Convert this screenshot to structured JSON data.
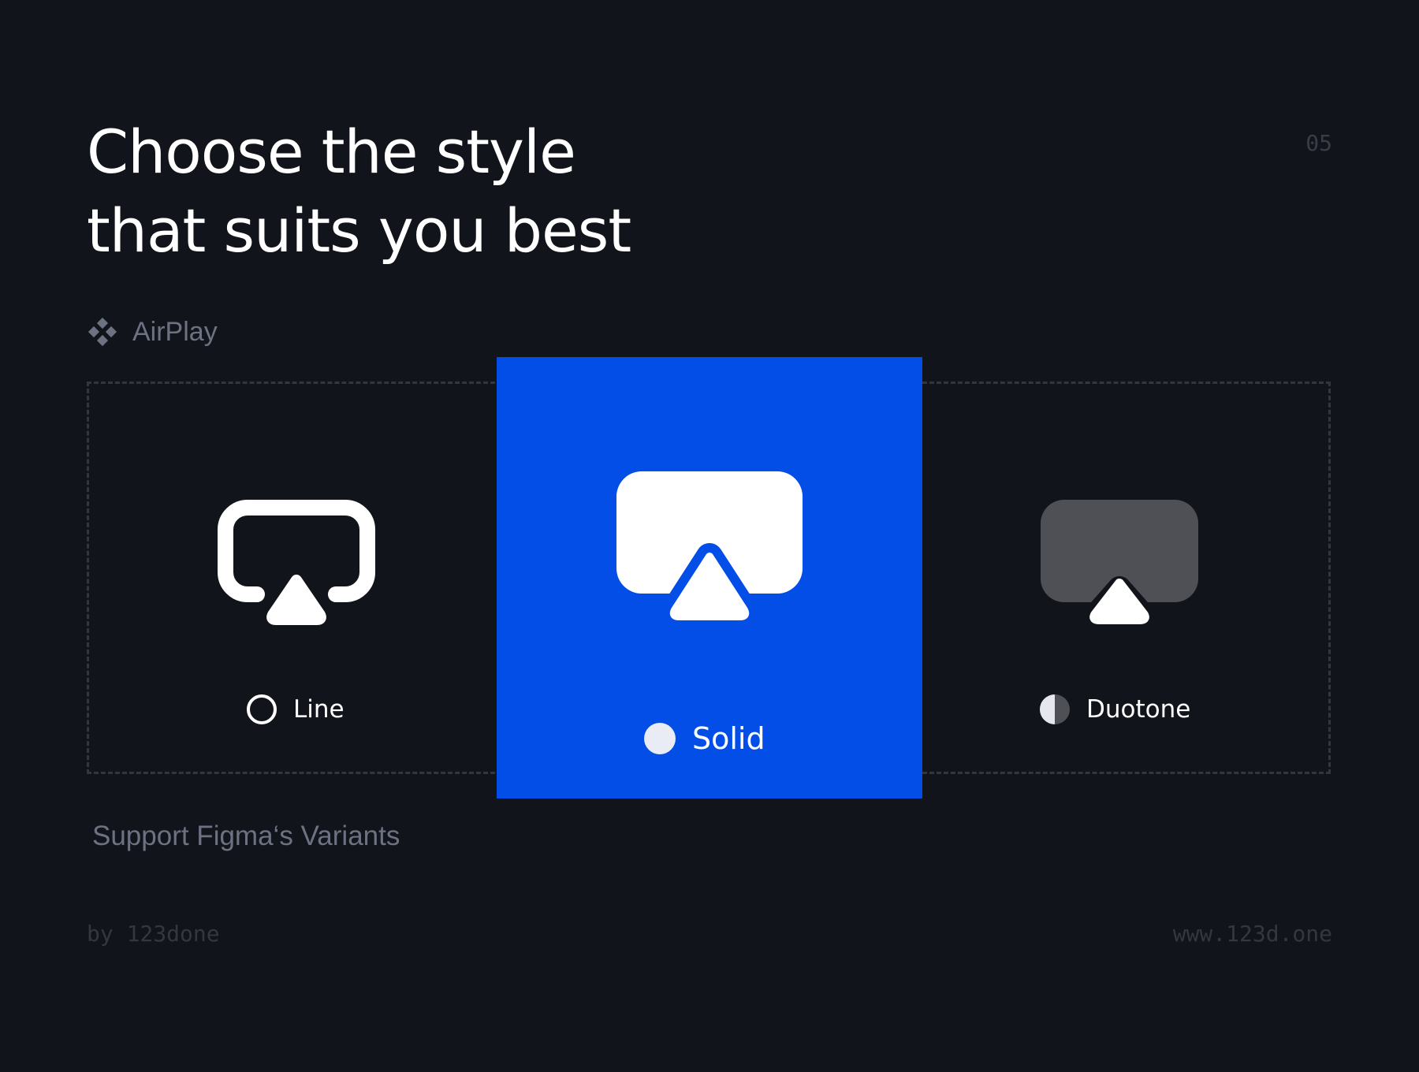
{
  "header": {
    "title_line_1": "Choose the style",
    "title_line_2": "that suits you best",
    "page_number": "05"
  },
  "component": {
    "icon": "figma-component-icon",
    "name": "AirPlay"
  },
  "variants": [
    {
      "label": "Line",
      "icon": "airplay-line-icon",
      "indicator": "radio-empty-icon"
    },
    {
      "label": "Solid",
      "icon": "airplay-solid-icon",
      "indicator": "radio-filled-icon",
      "background": "#034ee6",
      "selected": true
    },
    {
      "label": "Duotone",
      "icon": "airplay-duotone-icon",
      "indicator": "half-filled-circle-icon"
    }
  ],
  "support_text": "Support Figma‘s Variants",
  "footer": {
    "author": "by 123done",
    "website": "www.123d.one"
  },
  "colors": {
    "background": "#12141b",
    "accent": "#034ee6",
    "muted_text": "#6d7282",
    "duotone_fill": "#4f5055"
  }
}
